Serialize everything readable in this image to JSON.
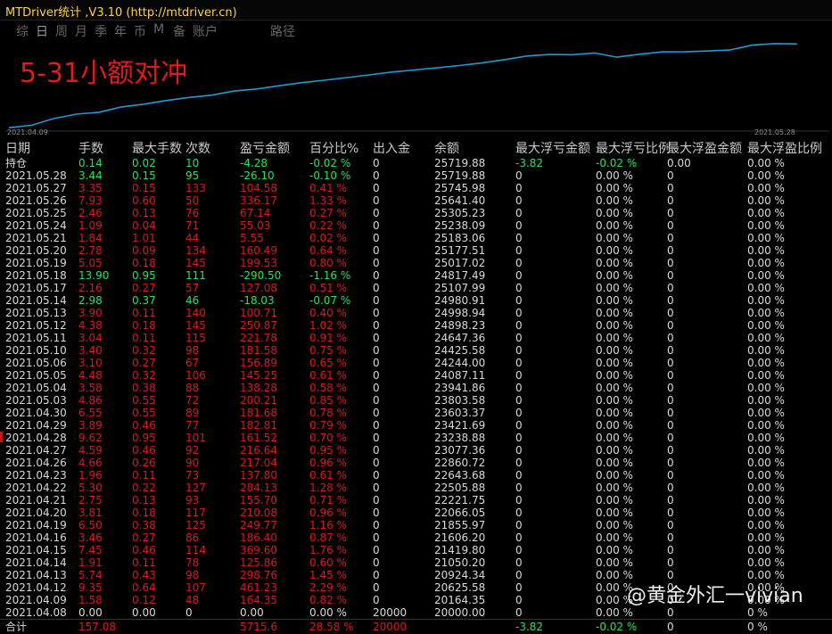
{
  "window": {
    "title": "MTDriver统计 ,V3.10 (http://mtdriver.cn)"
  },
  "tabs": [
    {
      "label": "综",
      "active": false
    },
    {
      "label": "日",
      "active": true
    },
    {
      "label": "周",
      "active": false
    },
    {
      "label": "月",
      "active": false
    },
    {
      "label": "季",
      "active": false
    },
    {
      "label": "年",
      "active": false
    },
    {
      "label": "币",
      "active": false
    },
    {
      "label": "M",
      "active": false
    },
    {
      "label": "备",
      "active": false
    },
    {
      "label": "账户",
      "active": false
    },
    {
      "label": "路径",
      "active": false
    }
  ],
  "overlay_text": "5-31小额对冲",
  "chart_data": {
    "type": "line",
    "x_start_label": "2021.04.09",
    "x_end_label": "2021.05.28",
    "line_color": "#1e9ad6",
    "series": [
      {
        "values": [
          20000,
          20164.35,
          20625.58,
          20924.34,
          21050.2,
          21419.8,
          21606.2,
          21855.97,
          22066.05,
          22221.75,
          22505.88,
          22643.68,
          22860.72,
          23077.36,
          23238.88,
          23421.69,
          23603.37,
          23803.58,
          23941.86,
          24087.11,
          24244.0,
          24425.58,
          24647.36,
          24898.23,
          24998.94,
          24980.91,
          25107.99,
          24817.49,
          25017.02,
          25177.51,
          25183.06,
          25238.09,
          25305.23,
          25641.4,
          25745.98,
          25719.88
        ]
      }
    ],
    "ylim": [
      19950,
      25800
    ]
  },
  "columns": [
    "日期",
    "手数",
    "最大手数",
    "次数",
    "盈亏金额",
    "百分比%",
    "出入金",
    "余额",
    "最大浮亏金额",
    "最大浮亏比例",
    "最大浮盈金额",
    "最大浮盈比例"
  ],
  "rows": [
    {
      "date": "持仓",
      "lots": "0.14",
      "max_lots": "0.02",
      "count": "10",
      "pnl": "-4.28",
      "pct": "-0.02 %",
      "io": "0",
      "bal": "25719.88",
      "mfl": "-3.82",
      "mflp": "-0.02 %",
      "mfp": "0.00",
      "mfpp": "0.00 %",
      "color": "green"
    },
    {
      "date": "2021.05.28",
      "lots": "3.44",
      "max_lots": "0.15",
      "count": "95",
      "pnl": "-26.10",
      "pct": "-0.10 %",
      "io": "0",
      "bal": "25719.88",
      "mfl": "0",
      "mflp": "0.00 %",
      "mfp": "0",
      "mfpp": "0.00 %",
      "color": "green"
    },
    {
      "date": "2021.05.27",
      "lots": "3.35",
      "max_lots": "0.15",
      "count": "133",
      "pnl": "104.58",
      "pct": "0.41 %",
      "io": "0",
      "bal": "25745.98",
      "mfl": "0",
      "mflp": "0.00 %",
      "mfp": "0",
      "mfpp": "0.00 %",
      "color": "red"
    },
    {
      "date": "2021.05.26",
      "lots": "7.93",
      "max_lots": "0.60",
      "count": "50",
      "pnl": "336.17",
      "pct": "1.33 %",
      "io": "0",
      "bal": "25641.40",
      "mfl": "0",
      "mflp": "0.00 %",
      "mfp": "0",
      "mfpp": "0.00 %",
      "color": "red"
    },
    {
      "date": "2021.05.25",
      "lots": "2.46",
      "max_lots": "0.13",
      "count": "76",
      "pnl": "67.14",
      "pct": "0.27 %",
      "io": "0",
      "bal": "25305.23",
      "mfl": "0",
      "mflp": "0.00 %",
      "mfp": "0",
      "mfpp": "0.00 %",
      "color": "red"
    },
    {
      "date": "2021.05.24",
      "lots": "1.09",
      "max_lots": "0.04",
      "count": "71",
      "pnl": "55.03",
      "pct": "0.22 %",
      "io": "0",
      "bal": "25238.09",
      "mfl": "0",
      "mflp": "0.00 %",
      "mfp": "0",
      "mfpp": "0.00 %",
      "color": "red"
    },
    {
      "date": "2021.05.21",
      "lots": "1.84",
      "max_lots": "1.01",
      "count": "44",
      "pnl": "5.55",
      "pct": "0.02 %",
      "io": "0",
      "bal": "25183.06",
      "mfl": "0",
      "mflp": "0.00 %",
      "mfp": "0",
      "mfpp": "0.00 %",
      "color": "red"
    },
    {
      "date": "2021.05.20",
      "lots": "2.78",
      "max_lots": "0.09",
      "count": "134",
      "pnl": "160.49",
      "pct": "0.64 %",
      "io": "0",
      "bal": "25177.51",
      "mfl": "0",
      "mflp": "0.00 %",
      "mfp": "0",
      "mfpp": "0.00 %",
      "color": "red"
    },
    {
      "date": "2021.05.19",
      "lots": "5.05",
      "max_lots": "0.18",
      "count": "145",
      "pnl": "199.53",
      "pct": "0.80 %",
      "io": "0",
      "bal": "25017.02",
      "mfl": "0",
      "mflp": "0.00 %",
      "mfp": "0",
      "mfpp": "0.00 %",
      "color": "red"
    },
    {
      "date": "2021.05.18",
      "lots": "13.90",
      "max_lots": "0.95",
      "count": "111",
      "pnl": "-290.50",
      "pct": "-1.16 %",
      "io": "0",
      "bal": "24817.49",
      "mfl": "0",
      "mflp": "0.00 %",
      "mfp": "0",
      "mfpp": "0.00 %",
      "color": "green"
    },
    {
      "date": "2021.05.17",
      "lots": "2.16",
      "max_lots": "0.27",
      "count": "57",
      "pnl": "127.08",
      "pct": "0.51 %",
      "io": "0",
      "bal": "25107.99",
      "mfl": "0",
      "mflp": "0.00 %",
      "mfp": "0",
      "mfpp": "0.00 %",
      "color": "red"
    },
    {
      "date": "2021.05.14",
      "lots": "2.98",
      "max_lots": "0.37",
      "count": "46",
      "pnl": "-18.03",
      "pct": "-0.07 %",
      "io": "0",
      "bal": "24980.91",
      "mfl": "0",
      "mflp": "0.00 %",
      "mfp": "0",
      "mfpp": "0.00 %",
      "color": "green"
    },
    {
      "date": "2021.05.13",
      "lots": "3.90",
      "max_lots": "0.11",
      "count": "140",
      "pnl": "100.71",
      "pct": "0.40 %",
      "io": "0",
      "bal": "24998.94",
      "mfl": "0",
      "mflp": "0.00 %",
      "mfp": "0",
      "mfpp": "0.00 %",
      "color": "red"
    },
    {
      "date": "2021.05.12",
      "lots": "4.38",
      "max_lots": "0.18",
      "count": "145",
      "pnl": "250.87",
      "pct": "1.02 %",
      "io": "0",
      "bal": "24898.23",
      "mfl": "0",
      "mflp": "0.00 %",
      "mfp": "0",
      "mfpp": "0.00 %",
      "color": "red"
    },
    {
      "date": "2021.05.11",
      "lots": "3.04",
      "max_lots": "0.11",
      "count": "115",
      "pnl": "221.78",
      "pct": "0.91 %",
      "io": "0",
      "bal": "24647.36",
      "mfl": "0",
      "mflp": "0.00 %",
      "mfp": "0",
      "mfpp": "0.00 %",
      "color": "red"
    },
    {
      "date": "2021.05.10",
      "lots": "3.40",
      "max_lots": "0.32",
      "count": "98",
      "pnl": "181.58",
      "pct": "0.75 %",
      "io": "0",
      "bal": "24425.58",
      "mfl": "0",
      "mflp": "0.00 %",
      "mfp": "0",
      "mfpp": "0.00 %",
      "color": "red"
    },
    {
      "date": "2021.05.06",
      "lots": "3.10",
      "max_lots": "0.27",
      "count": "67",
      "pnl": "156.89",
      "pct": "0.65 %",
      "io": "0",
      "bal": "24244.00",
      "mfl": "0",
      "mflp": "0.00 %",
      "mfp": "0",
      "mfpp": "0.00 %",
      "color": "red"
    },
    {
      "date": "2021.05.05",
      "lots": "4.48",
      "max_lots": "0.32",
      "count": "106",
      "pnl": "145.25",
      "pct": "0.61 %",
      "io": "0",
      "bal": "24087.11",
      "mfl": "0",
      "mflp": "0.00 %",
      "mfp": "0",
      "mfpp": "0.00 %",
      "color": "red"
    },
    {
      "date": "2021.05.04",
      "lots": "3.58",
      "max_lots": "0.38",
      "count": "88",
      "pnl": "138.28",
      "pct": "0.58 %",
      "io": "0",
      "bal": "23941.86",
      "mfl": "0",
      "mflp": "0.00 %",
      "mfp": "0",
      "mfpp": "0.00 %",
      "color": "red"
    },
    {
      "date": "2021.05.03",
      "lots": "4.86",
      "max_lots": "0.55",
      "count": "72",
      "pnl": "200.21",
      "pct": "0.85 %",
      "io": "0",
      "bal": "23803.58",
      "mfl": "0",
      "mflp": "0.00 %",
      "mfp": "0",
      "mfpp": "0.00 %",
      "color": "red"
    },
    {
      "date": "2021.04.30",
      "lots": "6.55",
      "max_lots": "0.55",
      "count": "89",
      "pnl": "181.68",
      "pct": "0.78 %",
      "io": "0",
      "bal": "23603.37",
      "mfl": "0",
      "mflp": "0.00 %",
      "mfp": "0",
      "mfpp": "0.00 %",
      "color": "red"
    },
    {
      "date": "2021.04.29",
      "lots": "3.89",
      "max_lots": "0.46",
      "count": "77",
      "pnl": "182.81",
      "pct": "0.79 %",
      "io": "0",
      "bal": "23421.69",
      "mfl": "0",
      "mflp": "0.00 %",
      "mfp": "0",
      "mfpp": "0.00 %",
      "color": "red"
    },
    {
      "date": "2021.04.28",
      "lots": "9.62",
      "max_lots": "0.95",
      "count": "101",
      "pnl": "161.52",
      "pct": "0.70 %",
      "io": "0",
      "bal": "23238.88",
      "mfl": "0",
      "mflp": "0.00 %",
      "mfp": "0",
      "mfpp": "0.00 %",
      "color": "red"
    },
    {
      "date": "2021.04.27",
      "lots": "4.59",
      "max_lots": "0.46",
      "count": "92",
      "pnl": "216.64",
      "pct": "0.95 %",
      "io": "0",
      "bal": "23077.36",
      "mfl": "0",
      "mflp": "0.00 %",
      "mfp": "0",
      "mfpp": "0.00 %",
      "color": "red"
    },
    {
      "date": "2021.04.26",
      "lots": "4.66",
      "max_lots": "0.26",
      "count": "90",
      "pnl": "217.04",
      "pct": "0.96 %",
      "io": "0",
      "bal": "22860.72",
      "mfl": "0",
      "mflp": "0.00 %",
      "mfp": "0",
      "mfpp": "0.00 %",
      "color": "red"
    },
    {
      "date": "2021.04.23",
      "lots": "1.96",
      "max_lots": "0.11",
      "count": "73",
      "pnl": "137.80",
      "pct": "0.61 %",
      "io": "0",
      "bal": "22643.68",
      "mfl": "0",
      "mflp": "0.00 %",
      "mfp": "0",
      "mfpp": "0.00 %",
      "color": "red"
    },
    {
      "date": "2021.04.22",
      "lots": "5.30",
      "max_lots": "0.22",
      "count": "127",
      "pnl": "284.13",
      "pct": "1.28 %",
      "io": "0",
      "bal": "22505.88",
      "mfl": "0",
      "mflp": "0.00 %",
      "mfp": "0",
      "mfpp": "0.00 %",
      "color": "red"
    },
    {
      "date": "2021.04.21",
      "lots": "2.75",
      "max_lots": "0.13",
      "count": "93",
      "pnl": "155.70",
      "pct": "0.71 %",
      "io": "0",
      "bal": "22221.75",
      "mfl": "0",
      "mflp": "0.00 %",
      "mfp": "0",
      "mfpp": "0.00 %",
      "color": "red"
    },
    {
      "date": "2021.04.20",
      "lots": "3.81",
      "max_lots": "0.18",
      "count": "117",
      "pnl": "210.08",
      "pct": "0.96 %",
      "io": "0",
      "bal": "22066.05",
      "mfl": "0",
      "mflp": "0.00 %",
      "mfp": "0",
      "mfpp": "0.00 %",
      "color": "red"
    },
    {
      "date": "2021.04.19",
      "lots": "6.50",
      "max_lots": "0.38",
      "count": "125",
      "pnl": "249.77",
      "pct": "1.16 %",
      "io": "0",
      "bal": "21855.97",
      "mfl": "0",
      "mflp": "0.00 %",
      "mfp": "0",
      "mfpp": "0.00 %",
      "color": "red"
    },
    {
      "date": "2021.04.16",
      "lots": "3.46",
      "max_lots": "0.27",
      "count": "86",
      "pnl": "186.40",
      "pct": "0.87 %",
      "io": "0",
      "bal": "21606.20",
      "mfl": "0",
      "mflp": "0.00 %",
      "mfp": "0",
      "mfpp": "0.00 %",
      "color": "red"
    },
    {
      "date": "2021.04.15",
      "lots": "7.45",
      "max_lots": "0.46",
      "count": "114",
      "pnl": "369.60",
      "pct": "1.76 %",
      "io": "0",
      "bal": "21419.80",
      "mfl": "0",
      "mflp": "0.00 %",
      "mfp": "0",
      "mfpp": "0.00 %",
      "color": "red"
    },
    {
      "date": "2021.04.14",
      "lots": "1.91",
      "max_lots": "0.11",
      "count": "78",
      "pnl": "125.86",
      "pct": "0.60 %",
      "io": "0",
      "bal": "21050.20",
      "mfl": "0",
      "mflp": "0.00 %",
      "mfp": "0",
      "mfpp": "0.00 %",
      "color": "red"
    },
    {
      "date": "2021.04.13",
      "lots": "5.74",
      "max_lots": "0.43",
      "count": "98",
      "pnl": "298.76",
      "pct": "1.45 %",
      "io": "0",
      "bal": "20924.34",
      "mfl": "0",
      "mflp": "0.00 %",
      "mfp": "0",
      "mfpp": "0.00 %",
      "color": "red"
    },
    {
      "date": "2021.04.12",
      "lots": "9.35",
      "max_lots": "0.64",
      "count": "107",
      "pnl": "461.23",
      "pct": "2.29 %",
      "io": "0",
      "bal": "20625.58",
      "mfl": "0",
      "mflp": "0.00 %",
      "mfp": "0",
      "mfpp": "0.00 %",
      "color": "red"
    },
    {
      "date": "2021.04.09",
      "lots": "1.58",
      "max_lots": "0.12",
      "count": "48",
      "pnl": "164.35",
      "pct": "0.82 %",
      "io": "0",
      "bal": "20164.35",
      "mfl": "0",
      "mflp": "0.00 %",
      "mfp": "0",
      "mfpp": "0.00 %",
      "color": "red"
    },
    {
      "date": "2021.04.08",
      "lots": "0.00",
      "max_lots": "0.00",
      "count": "0",
      "pnl": "0.00",
      "pct": "0.00 %",
      "io": "20000",
      "bal": "20000.00",
      "mfl": "0",
      "mflp": "0.00 %",
      "mfp": "0",
      "mfpp": "0 %",
      "color": "white"
    }
  ],
  "total": {
    "label": "合计",
    "lots": "157.08",
    "pnl": "5715.6",
    "pct": "28.58 %",
    "io": "20000",
    "mfl": "-3.82",
    "mflp": "-0.02 %",
    "mfp": "0",
    "mfpp": "0 %"
  },
  "watermark": "@黄金外汇一vivian",
  "colors": {
    "positive": "#d81b1b",
    "negative": "#2ee05a",
    "line": "#1e9ad6",
    "title": "#ffd23a",
    "overlay": "#e11a1a"
  }
}
